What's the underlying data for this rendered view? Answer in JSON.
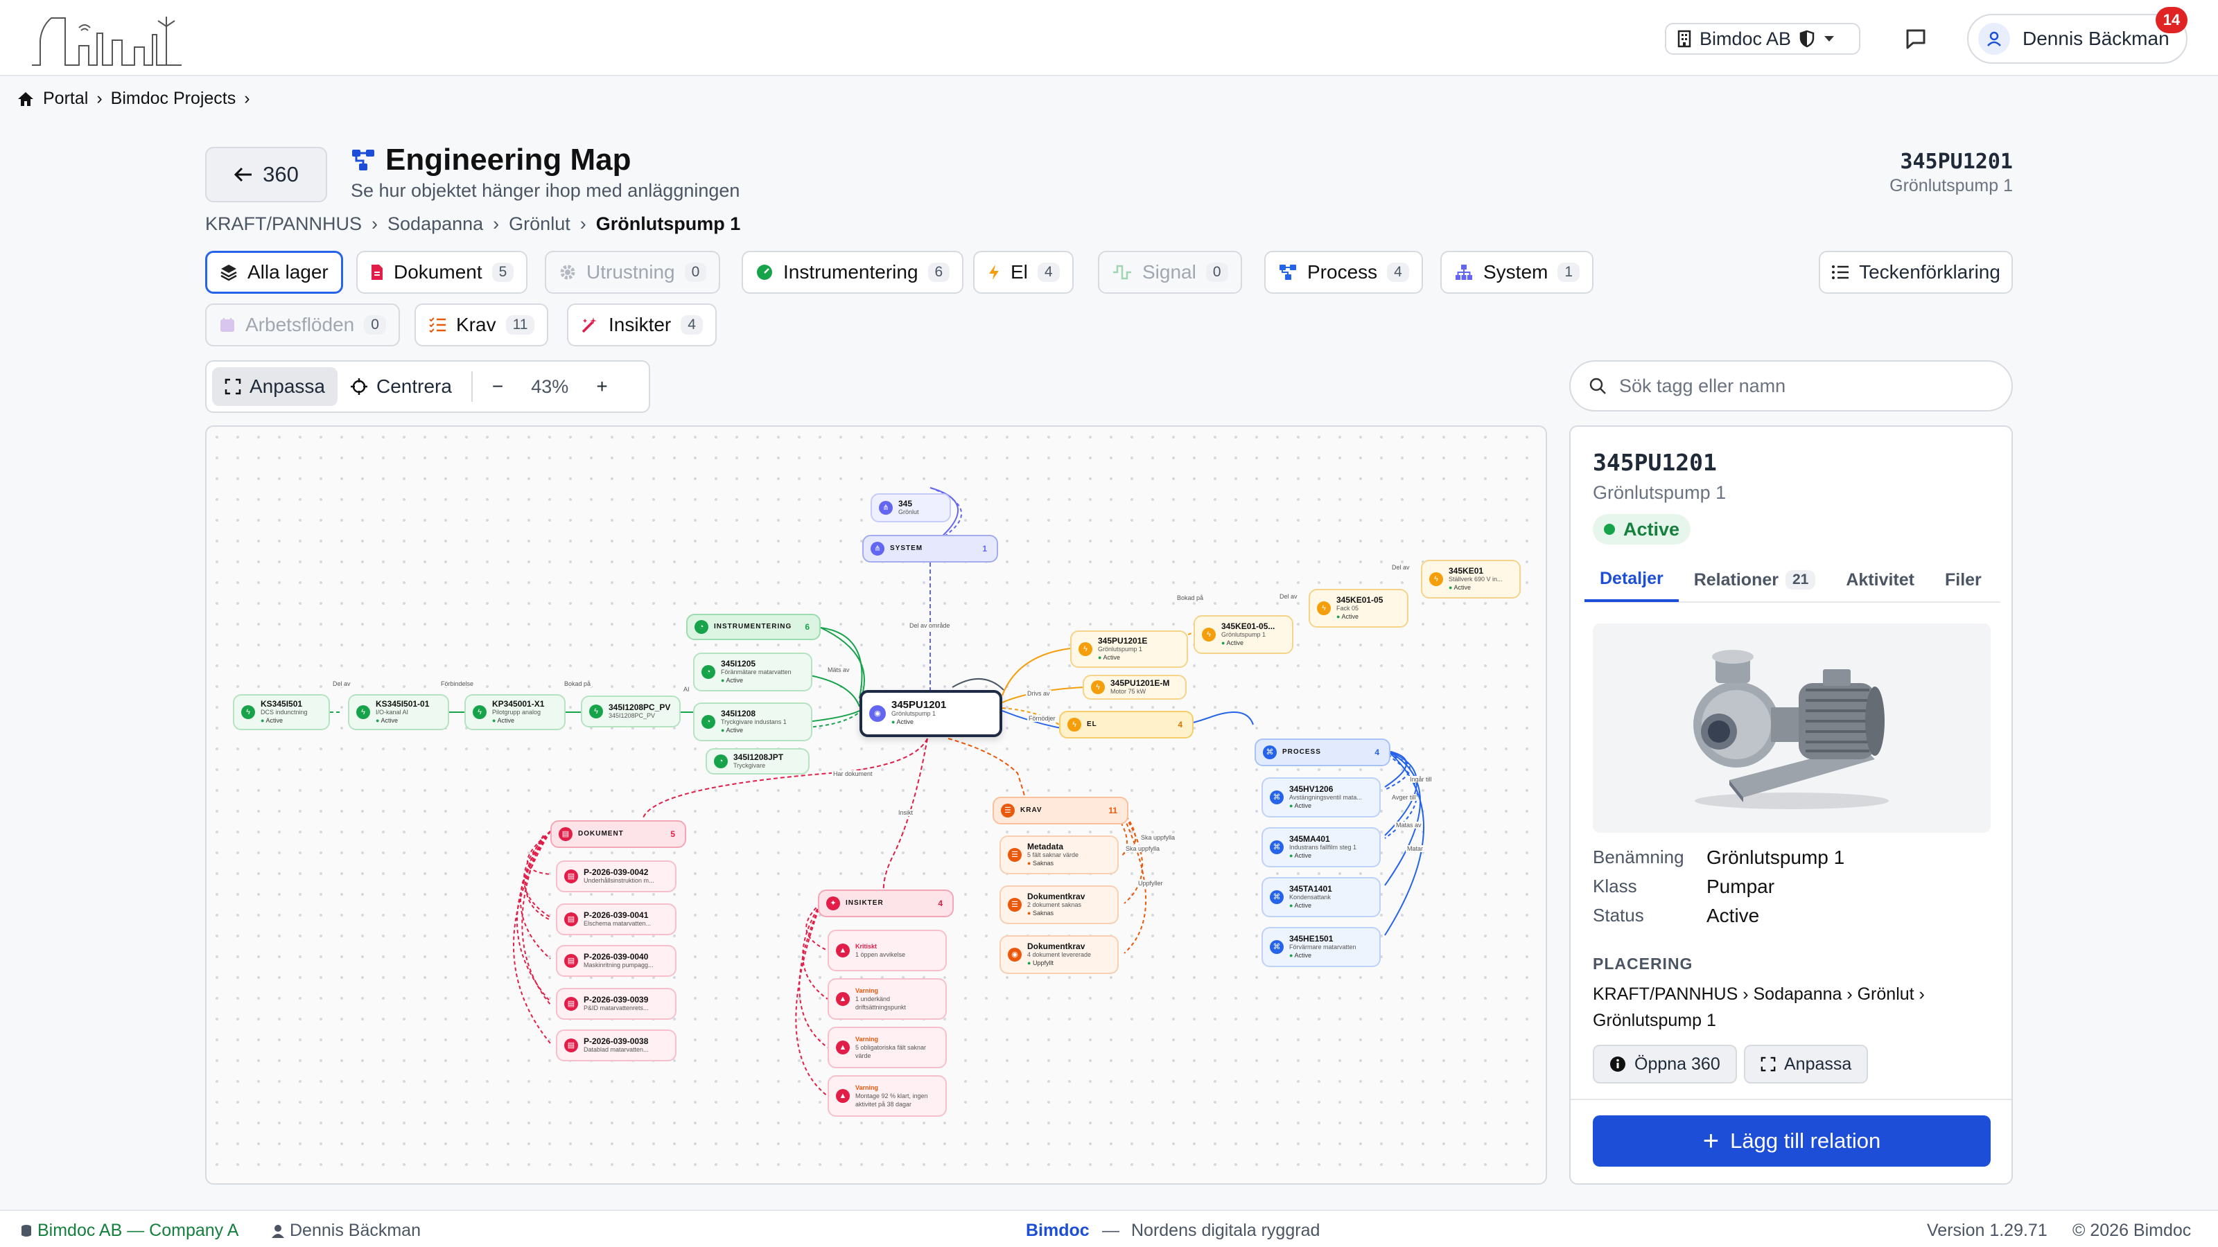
{
  "header": {
    "org": "Bimdoc AB",
    "user": "Dennis Bäckman",
    "notifications": "14"
  },
  "breadcrumb": [
    "Portal",
    "Bimdoc Projects"
  ],
  "page": {
    "back_label": "360",
    "title": "Engineering Map",
    "subtitle": "Se hur objektet hänger ihop med anläggningen",
    "tag": "345PU1201",
    "tag_name": "Grönlutspump 1",
    "path": [
      "KRAFT/PANNHUS",
      "Sodapanna",
      "Grönlut",
      "Grönlutspump 1"
    ]
  },
  "filters": [
    {
      "label": "Alla lager",
      "count": ""
    },
    {
      "label": "Dokument",
      "count": "5"
    },
    {
      "label": "Utrustning",
      "count": "0"
    },
    {
      "label": "Instrumentering",
      "count": "6"
    },
    {
      "label": "El",
      "count": "4"
    },
    {
      "label": "Signal",
      "count": "0"
    },
    {
      "label": "Process",
      "count": "4"
    },
    {
      "label": "System",
      "count": "1"
    },
    {
      "label": "Arbetsflöden",
      "count": "0"
    },
    {
      "label": "Krav",
      "count": "11"
    },
    {
      "label": "Insikter",
      "count": "4"
    }
  ],
  "legend_label": "Teckenförklaring",
  "toolbar": {
    "fit": "Anpassa",
    "center": "Centrera",
    "zoom": "43%",
    "minus": "−",
    "plus": "+"
  },
  "search": {
    "placeholder": "Sök tagg eller namn"
  },
  "graph": {
    "nodes": [
      {
        "id": "345",
        "sub": "Grönlut"
      },
      {
        "id": "SYSTEM",
        "count": "1"
      },
      {
        "id": "INSTRUMENTERING",
        "count": "6"
      },
      {
        "id": "345I1205",
        "sub": "Föränmätare matarvatten",
        "status": "Active"
      },
      {
        "id": "345I1208",
        "sub": "Tryckgivare industans 1",
        "status": "Active"
      },
      {
        "id": "345I1208JPT",
        "sub": "Tryckgivare"
      },
      {
        "id": "345I1208PC_PV",
        "sub": "345I1208PC_PV"
      },
      {
        "id": "KP345001-X1",
        "sub": "Pilotgrupp analog",
        "status": "Active"
      },
      {
        "id": "KS345I501-01",
        "sub": "I/O-kanal AI",
        "status": "Active"
      },
      {
        "id": "KS345I501",
        "sub": "DCS indunctning",
        "status": "Active"
      },
      {
        "id": "345PU1201",
        "sub": "Grönlutspump 1",
        "status": "Active"
      },
      {
        "id": "345PU1201E",
        "sub": "Grönlutspump 1",
        "status": "Active"
      },
      {
        "id": "345PU1201E-M",
        "sub": "Motor 75 kW"
      },
      {
        "id": "EL",
        "count": "4"
      },
      {
        "id": "345KE01-05...",
        "sub": "Grönlutspump 1",
        "status": "Active"
      },
      {
        "id": "345KE01-05",
        "sub": "Fack 05",
        "status": "Active"
      },
      {
        "id": "345KE01",
        "sub": "Ställverk 690 V in...",
        "status": "Active"
      },
      {
        "id": "PROCESS",
        "count": "4"
      },
      {
        "id": "345HV1206",
        "sub": "Avstängningsventil mata...",
        "status": "Active"
      },
      {
        "id": "345MA401",
        "sub": "Industrans fallfilm steg 1",
        "status": "Active"
      },
      {
        "id": "345TA1401",
        "sub": "Kondensattank",
        "status": "Active"
      },
      {
        "id": "345HE1501",
        "sub": "Förvärmare matarvatten",
        "status": "Active"
      },
      {
        "id": "DOKUMENT",
        "count": "5"
      },
      {
        "id": "P-2026-039-0042",
        "sub": "Underhållsinstruktion m..."
      },
      {
        "id": "P-2026-039-0041",
        "sub": "Elschema matarvatten..."
      },
      {
        "id": "P-2026-039-0040",
        "sub": "Maskinritning pumpagg..."
      },
      {
        "id": "P-2026-039-0039",
        "sub": "P&ID matarvattenrets..."
      },
      {
        "id": "P-2026-039-0038",
        "sub": "Datablad matarvatten..."
      },
      {
        "id": "KRAV",
        "count": "11"
      },
      {
        "id": "Metadata",
        "sub": "5 fält saknar värde",
        "status": "Saknas"
      },
      {
        "id": "Dokumentkrav",
        "sub": "2 dokument saknas",
        "status": "Saknas"
      },
      {
        "id": "Dokumentkrav ",
        "sub": "4 dokument levererade",
        "status": "Uppfyllt"
      },
      {
        "id": "INSIKTER",
        "count": "4"
      },
      {
        "id": "Kritiskt",
        "sub": "1 öppen avvikelse"
      },
      {
        "id": "Varning",
        "sub": "1 underkänd driftsättningspunkt"
      },
      {
        "id": "Varning ",
        "sub": "5 obligatoriska fält saknar värde"
      },
      {
        "id": "Varning  ",
        "sub": "Montage 92 % klart, ingen aktivitet på 38 dagar"
      }
    ],
    "edge_labels": [
      "Del av område",
      "Del av",
      "Förbindelse",
      "Bokad på",
      "AI",
      "Mäts av",
      "Drivs av",
      "Förnödjer",
      "Bokad på",
      "Del av",
      "Del av",
      "Har dokument",
      "Insikt",
      "Ska uppfylla",
      "Ska uppfylla",
      "Uppfyller",
      "Ingår till",
      "Avger till",
      "Matas av",
      "Matar"
    ]
  },
  "panel": {
    "tag": "345PU1201",
    "name": "Grönlutspump 1",
    "status": "Active",
    "tabs": [
      {
        "label": "Detaljer",
        "count": ""
      },
      {
        "label": "Relationer",
        "count": "21"
      },
      {
        "label": "Aktivitet",
        "count": ""
      },
      {
        "label": "Filer",
        "count": ""
      }
    ],
    "fields": [
      {
        "key": "Benämning",
        "value": "Grönlutspump 1"
      },
      {
        "key": "Klass",
        "value": "Pumpar"
      },
      {
        "key": "Status",
        "value": "Active"
      }
    ],
    "placement_title": "PLACERING",
    "placement": "KRAFT/PANNHUS › Sodapanna › Grönlut › Grönlutspump 1",
    "open360": "Öppna 360",
    "fit": "Anpassa",
    "add_relation": "Lägg till relation"
  },
  "footer": {
    "company": "Bimdoc AB — Company A",
    "user": "Dennis Bäckman",
    "brand": "Bimdoc",
    "dash": "—",
    "tagline": "Nordens digitala ryggrad",
    "version": "Version 1.29.71",
    "copyright": "© 2026 Bimdoc"
  },
  "colors": {
    "primary": "#1d4ed8",
    "instrument": "#16a34a",
    "el": "#f59e0b",
    "process": "#2563eb",
    "system": "#6366f1",
    "dokument": "#e11d48",
    "krav": "#ea580c",
    "insikter": "#e11d48",
    "badge": "#e02424"
  }
}
